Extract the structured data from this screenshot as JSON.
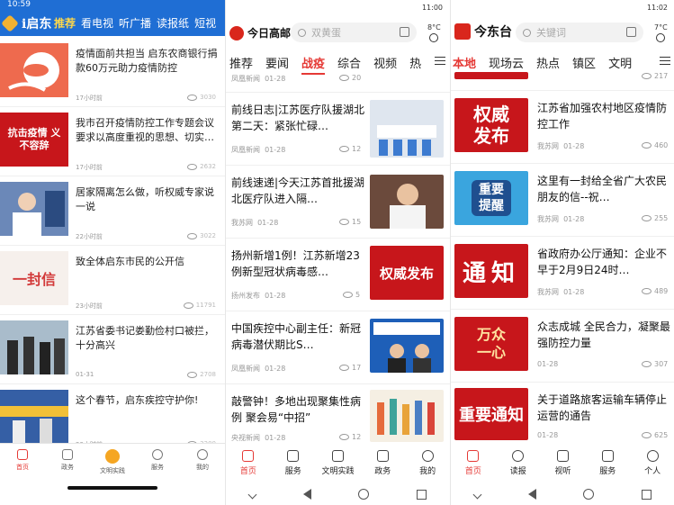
{
  "panel1": {
    "status_time": "10:59",
    "logo_text": "i启东",
    "tabs": [
      "推荐",
      "看电视",
      "听广播",
      "读报纸",
      "短视"
    ],
    "articles": [
      {
        "title": "疫情面前共担当 启东农商银行捐款60万元助力疫情防控",
        "time": "17小时前",
        "views": "3030"
      },
      {
        "title": "我市召开疫情防控工作专题会议要求以高度重视的思想、切实…",
        "time": "17小时前",
        "views": "2632",
        "thumb_text": "抗击疫情 义不容辞"
      },
      {
        "title": "居家隔离怎么做，听权威专家说一说",
        "time": "22小时前",
        "views": "3022"
      },
      {
        "title": "致全体启东市民的公开信",
        "time": "23小时前",
        "views": "11791",
        "thumb_text": "一封信"
      },
      {
        "title": "江苏省委书记娄勤俭村口被拦，十分高兴",
        "time": "01-31",
        "views": "2708"
      },
      {
        "title": "这个春节，启东疾控守护你!",
        "time": "23小时前",
        "views": "3200"
      }
    ],
    "nav": [
      "首页",
      "政务",
      "文明实践",
      "服务",
      "我的"
    ]
  },
  "panel2": {
    "status_time": "11:00",
    "logo_text": "今日高邮",
    "search_placeholder": "双黄蛋",
    "temperature": "8°C",
    "tabs": [
      "推荐",
      "要闻",
      "战疫",
      "综合",
      "视频",
      "热"
    ],
    "top_partial": {
      "source": "凤凰新闻",
      "date": "01-28",
      "views": "20"
    },
    "articles": [
      {
        "title": "前线日志|江苏医疗队援湖北第二天：紧张忙碌…",
        "source": "凤凰新闻",
        "date": "01-28",
        "views": "12"
      },
      {
        "title": "前线速递|今天江苏首批援湖北医疗队进入隔…",
        "source": "我苏网",
        "date": "01-28",
        "views": "15"
      },
      {
        "title": "扬州新增1例！江苏新增23例新型冠状病毒感…",
        "source": "扬州发布",
        "date": "01-28",
        "views": "5",
        "thumb_text": "权威发布"
      },
      {
        "title": "中国疾控中心副主任：新冠病毒潜伏期比S…",
        "source": "凤凰新闻",
        "date": "01-28",
        "views": "17"
      },
      {
        "title": "敲警钟！多地出现聚集性病例 聚会易“中招”",
        "source": "央视新闻",
        "date": "01-28",
        "views": "12"
      }
    ],
    "nav": [
      "首页",
      "服务",
      "文明实践",
      "政务",
      "我的"
    ]
  },
  "panel3": {
    "status_time": "11:02",
    "logo_text": "今东台",
    "search_placeholder": "关键词",
    "temperature": "7°C",
    "tabs": [
      "本地",
      "现场云",
      "热点",
      "镇区",
      "文明"
    ],
    "top_partial_views": "217",
    "articles": [
      {
        "title": "江苏省加强农村地区疫情防控工作",
        "source": "我苏网",
        "date": "01-28",
        "views": "460",
        "thumb_text": "权威发布"
      },
      {
        "title": "这里有一封给全省广大农民朋友的信--祝…",
        "source": "我苏网",
        "date": "01-28",
        "views": "255",
        "thumb_text": "重要提醒"
      },
      {
        "title": "省政府办公厅通知：企业不早于2月9日24时…",
        "source": "我苏网",
        "date": "01-28",
        "views": "489",
        "thumb_text": "通知"
      },
      {
        "title": "众志成城 全民合力，凝聚最强防控力量",
        "source": "",
        "date": "01-28",
        "views": "307",
        "thumb_text": "万众一心"
      },
      {
        "title": "关于道路旅客运输车辆停止运营的通告",
        "source": "",
        "date": "01-28",
        "views": "625",
        "thumb_text": "重要通知"
      }
    ],
    "nav": [
      "首页",
      "读报",
      "视听",
      "服务",
      "个人"
    ]
  }
}
